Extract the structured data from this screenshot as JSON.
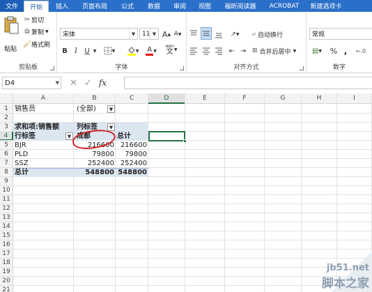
{
  "tabs": [
    {
      "label": "文件",
      "kind": "file"
    },
    {
      "label": "开始",
      "kind": "active"
    },
    {
      "label": "插入"
    },
    {
      "label": "页面布局"
    },
    {
      "label": "公式"
    },
    {
      "label": "数据"
    },
    {
      "label": "审阅"
    },
    {
      "label": "视图"
    },
    {
      "label": "福昕阅读器"
    },
    {
      "label": "ACROBAT"
    },
    {
      "label": "新建选项卡"
    }
  ],
  "ribbon": {
    "clipboard": {
      "paste": "粘贴",
      "cut": "剪切",
      "copy": "复制",
      "format_painter": "格式刷",
      "label": "剪贴板"
    },
    "font": {
      "name": "宋体",
      "size": "11",
      "grow": "A",
      "shrink": "A",
      "bold": "B",
      "italic": "I",
      "underline": "U",
      "label": "字体",
      "wen": "wén",
      "font_color_letter": "A"
    },
    "alignment": {
      "wrap": "自动换行",
      "merge": "合并后居中",
      "label": "对齐方式"
    },
    "number": {
      "format": "常规",
      "percent": "%",
      "comma": ",",
      "label": "数字"
    },
    "colors": {
      "accent": "#2a6fc9",
      "highlight": "#ffff00",
      "font_color": "#e01010"
    }
  },
  "formula_bar": {
    "name_box": "D4",
    "cancel": "✕",
    "enter": "✓",
    "fx": "fx",
    "value": ""
  },
  "sheet": {
    "columns": [
      "A",
      "B",
      "C",
      "D",
      "E",
      "F",
      "G",
      "H",
      "I"
    ],
    "active_column": "D",
    "rows": [
      "1",
      "2",
      "3",
      "4",
      "5",
      "6",
      "7",
      "8",
      "9",
      "10",
      "11",
      "12",
      "13",
      "14",
      "15",
      "16",
      "17",
      "18",
      "19",
      "20",
      "21"
    ],
    "active_row": "4",
    "active_cell": "D4",
    "cells": {
      "A1": "销售员",
      "B1": "(全部)",
      "A3": "求和项:销售额",
      "B3": "列标签",
      "A4": "行标签",
      "B4": "成都",
      "C4": "总计",
      "A5": "BJR",
      "B5": "216600",
      "C5": "216600",
      "A6": "PLD",
      "B6": "79800",
      "C6": "79800",
      "A7": "SSZ",
      "B7": "252400",
      "C7": "252400",
      "A8": "总计",
      "B8": "548800",
      "C8": "548800"
    }
  },
  "watermark": {
    "site": "jb51.net",
    "name": "脚本之家"
  }
}
